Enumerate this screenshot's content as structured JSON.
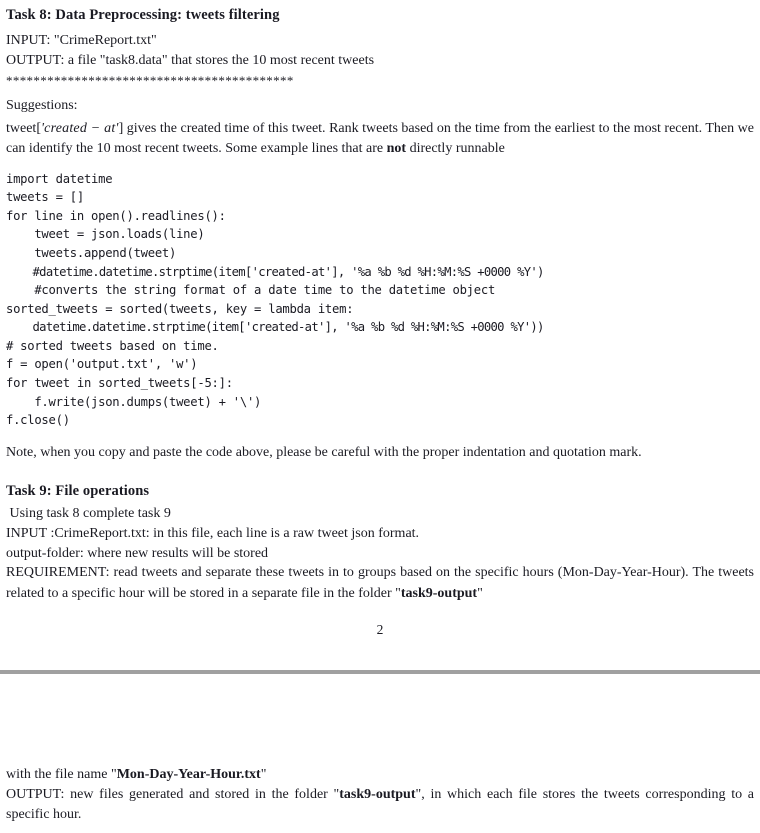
{
  "document": {
    "page_number": "2",
    "page_break_color": "#a0a0a0",
    "text_color": "#1a1a22"
  },
  "task8": {
    "heading": "Task 8: Data Preprocessing: tweets filtering",
    "input_line": "INPUT: \"CrimeReport.txt\"",
    "output_line": "OUTPUT: a file \"task8.data\" that stores the 10 most recent tweets",
    "separator": "******************************************",
    "suggestions_label": "Suggestions:",
    "suggestion_paragraph": {
      "prefix": "tweet[",
      "math_italic": "'created − at'",
      "middle": "] gives the created time of this tweet. Rank tweets based on the time from the earliest to the most recent. Then we can identify the 10 most recent tweets. Some example lines that are ",
      "bold": "not",
      "suffix": " directly runnable"
    },
    "code_lines": [
      "import datetime",
      "tweets = []",
      "for line in open().readlines():",
      "    tweet = json.loads(line)",
      "    tweets.append(tweet)",
      "    #datetime.datetime.strptime(item['created-at'], '%a %b %d %H:%M:%S +0000 %Y')",
      "    #converts the string format of a date time to the datetime object",
      "sorted_tweets = sorted(tweets, key = lambda item:",
      "    datetime.datetime.strptime(item['created-at'], '%a %b %d %H:%M:%S +0000 %Y'))",
      "# sorted tweets based on time.",
      "f = open('output.txt', 'w')",
      "for tweet in sorted_tweets[-5:]:",
      "    f.write(json.dumps(tweet) + '\\')",
      "f.close()"
    ],
    "note_paragraph": "Note, when you copy and paste the code above, please be careful with the proper indentation and quotation mark."
  },
  "task9": {
    "heading": "Task 9: File operations",
    "using_line": " Using task 8 complete task 9",
    "input_line": "INPUT :CrimeReport.txt: in this file, each line is a raw tweet json format.",
    "output_folder_line": "output-folder: where new results will be stored",
    "requirement_paragraph": {
      "text": "REQUIREMENT: read tweets and separate these tweets in to groups based on the specific hours (Mon-Day-Year-Hour). The tweets related to a specific hour will be stored in a separate file in the folder \"",
      "bold": "task9-output",
      "suffix": "\""
    },
    "filename_line": {
      "prefix": "with the file name \"",
      "bold": "Mon-Day-Year-Hour.txt",
      "suffix": "\""
    },
    "output_paragraph": {
      "prefix": "OUTPUT: new files generated and stored in the folder \"",
      "bold": "task9-output",
      "suffix": "\", in which each file stores the tweets corresponding to a specific hour."
    }
  }
}
